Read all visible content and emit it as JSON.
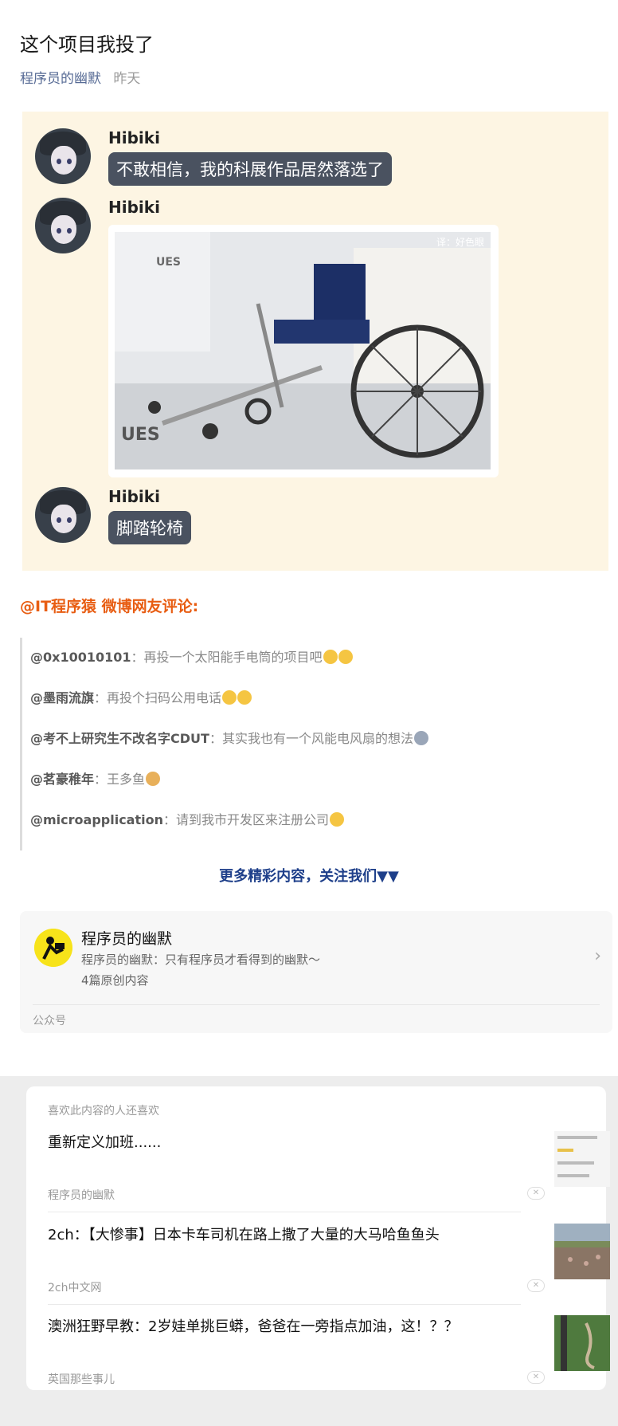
{
  "article": {
    "title": "这个项目我投了",
    "author": "程序员的幽默",
    "date": "昨天"
  },
  "chat": {
    "messages": [
      {
        "name": "Hibiki",
        "text": "不敢相信，我的科展作品居然落选了"
      },
      {
        "name": "Hibiki",
        "image_caption": "译：好色眼",
        "image_text": "UES"
      },
      {
        "name": "Hibiki",
        "text": "脚踏轮椅"
      }
    ]
  },
  "comments_title": "@IT程序猿 微博网友评论:",
  "comments": [
    {
      "user": "@0x10010101",
      "sep": "：",
      "text": "再投一个太阳能手电筒的项目吧"
    },
    {
      "user": "@墨雨流旗",
      "sep": "：",
      "text": "再投个扫码公用电话"
    },
    {
      "user": "@考不上研究生不改名字CDUT",
      "sep": "：",
      "text": "其实我也有一个风能电风扇的想法"
    },
    {
      "user": "@茗豪稚年",
      "sep": "：",
      "text": "王多鱼"
    },
    {
      "user": "@microapplication",
      "sep": "：",
      "text": "请到我市开发区来注册公司"
    }
  ],
  "more_label": "更多精彩内容，关注我们▼▼",
  "account_card": {
    "name": "程序员的幽默",
    "desc": "程序员的幽默：只有程序员才看得到的幽默～",
    "count": "4篇原创内容",
    "type": "公众号"
  },
  "recommend": {
    "header": "喜欢此内容的人还喜欢",
    "items": [
      {
        "title": "重新定义加班......",
        "source": "程序员的幽默"
      },
      {
        "title": "2ch：【大惨事】日本卡车司机在路上撒了大量的大马哈鱼鱼头",
        "source": "2ch中文网"
      },
      {
        "title": "澳洲狂野早教：2岁娃单挑巨蟒，爸爸在一旁指点加油，这！？？",
        "source": "英国那些事儿"
      }
    ]
  },
  "colors": {
    "link_blue": "#576b95",
    "accent_orange": "#e85d12",
    "more_blue": "#1e3f8a",
    "chat_bg": "#fdf5e3",
    "bubble_bg": "#4a5260"
  },
  "icons": {
    "chevron": "chevron-right-icon",
    "close": "close-icon"
  }
}
